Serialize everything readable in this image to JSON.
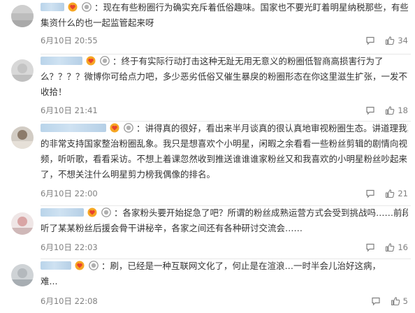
{
  "comments": [
    {
      "lines": [
        "：现在有些粉圈行为确实充斥着低俗趣味。国家也不要光盯着明星纳税那些，有些粉圈",
        "集资什么的也一起监管起来呀"
      ],
      "time": "6月10日 20:55",
      "likes": "34"
    },
    {
      "lines": [
        "：终于有实际行动打击这种无趾无用无意义的粉圈低智商高损害行为了",
        "么？？？？微博你可给点力吧，多少恶劣低俗又催生暴戾的粉圈形态在你这里滋生扩张，一发不可",
        "收拾！"
      ],
      "time": "6月10日 21:41",
      "likes": "18"
    },
    {
      "lines": [
        "：讲得真的很好，看出来半月谈真的很认真地审视粉圈生态。讲道理我真",
        "的非常支持国家整治粉圈乱象。我只是想喜欢个小明星，闲暇之余看看一些粉丝剪辑的剧情向视",
        "频，听听歌，看看采访。不想上着课忽然收到推送谁谁谁家粉丝又和我喜欢的小明星粉丝吵起来",
        "了，不想关注什么明星剪力榜我偶像的排名。"
      ],
      "time": "6月10日 22:00",
      "likes": "21"
    },
    {
      "lines": [
        "：各家粉头要开始捉急了吧？所谓的粉丝成熟运营方式会受到挑战吗……前段时间",
        "听了某某粉丝后援会骨干讲秘辛，各家之间还有各种研讨交流会……"
      ],
      "time": "6月10日 22:03",
      "likes": "16"
    },
    {
      "lines": [
        "：刷，已经是一种互联网文化了，何止是在渲浪…一时半会儿治好这病，",
        "难..."
      ],
      "time": "6月10日 22:08",
      "likes": "5"
    }
  ],
  "icons": {
    "reply": "comment-bubble-icon",
    "like": "thumbs-up-icon",
    "vip": "vip-heart-badge-icon",
    "level": "level-medal-badge-icon"
  },
  "colors": {
    "text": "#333333",
    "meta": "#808080",
    "name_blur": "#c2daee",
    "separator": "#e8e8e8"
  }
}
